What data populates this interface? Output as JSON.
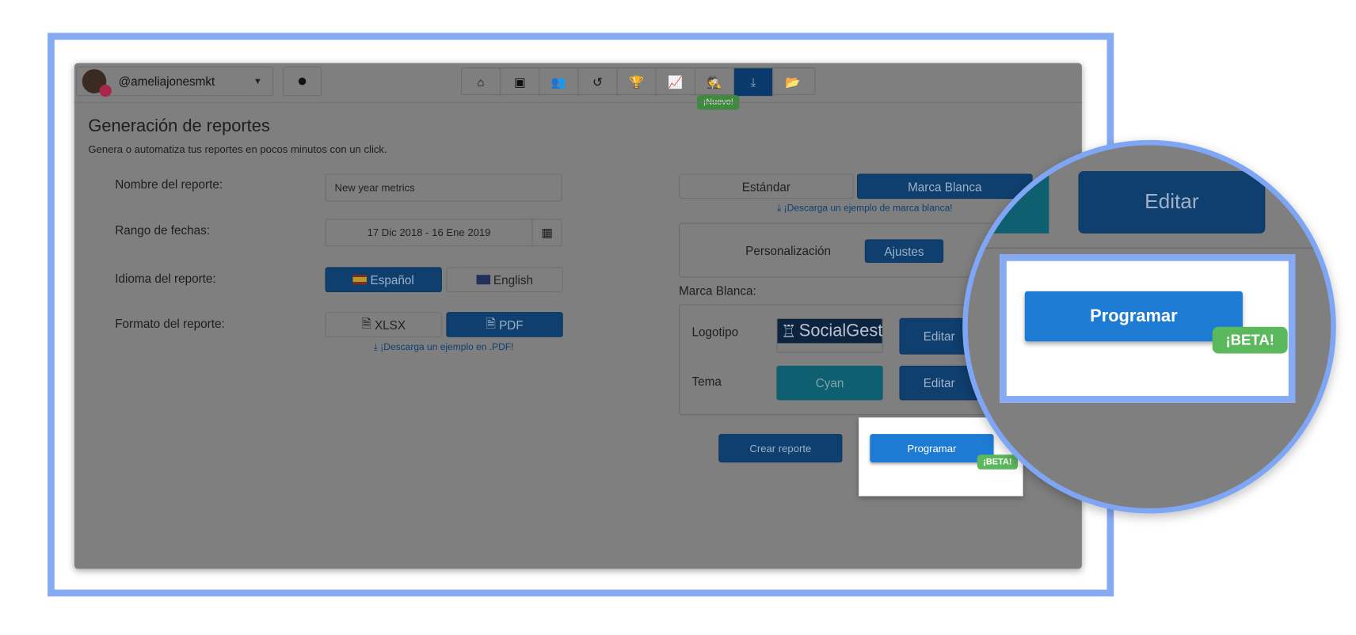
{
  "header": {
    "username": "@ameliajonesmkt",
    "nav_icons": [
      "home-icon",
      "image-icon",
      "users-icon",
      "history-icon",
      "trophy-icon",
      "chart-icon",
      "spy-icon",
      "download-icon",
      "folder-open-icon"
    ],
    "nav_glyphs": [
      "⌂",
      "▣",
      "👥",
      "↺",
      "🏆",
      "📈",
      "🕵",
      "⤓",
      "📂"
    ],
    "new_badge": "¡Nuevo!"
  },
  "page": {
    "title": "Generación de reportes",
    "subtitle": "Genera o automatiza tus reportes en pocos minutos con un click."
  },
  "form": {
    "name_label": "Nombre del reporte:",
    "name_value": "New year metrics",
    "range_label": "Rango de fechas:",
    "range_value": "17 Dic 2018 - 16 Ene 2019",
    "lang_label": "Idioma del reporte:",
    "lang_es": "Español",
    "lang_en": "English",
    "format_label": "Formato del reporte:",
    "format_xlsx": "XLSX",
    "format_pdf": "PDF",
    "pdf_link": "¡Descarga un ejemplo en .PDF!"
  },
  "branding": {
    "standard": "Estándar",
    "white_label": "Marca Blanca",
    "white_label_link": "¡Descarga un ejemplo de marca blanca!",
    "personalization": "Personalización",
    "settings": "Ajustes",
    "section_label": "Marca Blanca:",
    "logo_label": "Logotipo",
    "logo_text": "SocialGest",
    "edit": "Editar",
    "theme_label": "Tema",
    "theme_value": "Cyan"
  },
  "actions": {
    "create": "Crear reporte",
    "schedule": "Programar",
    "beta": "¡BETA!"
  },
  "colors": {
    "primary": "#1e7bd4",
    "dark_primary": "#0f3f6e",
    "beta": "#5cb85c",
    "frame": "#86aaf3"
  }
}
